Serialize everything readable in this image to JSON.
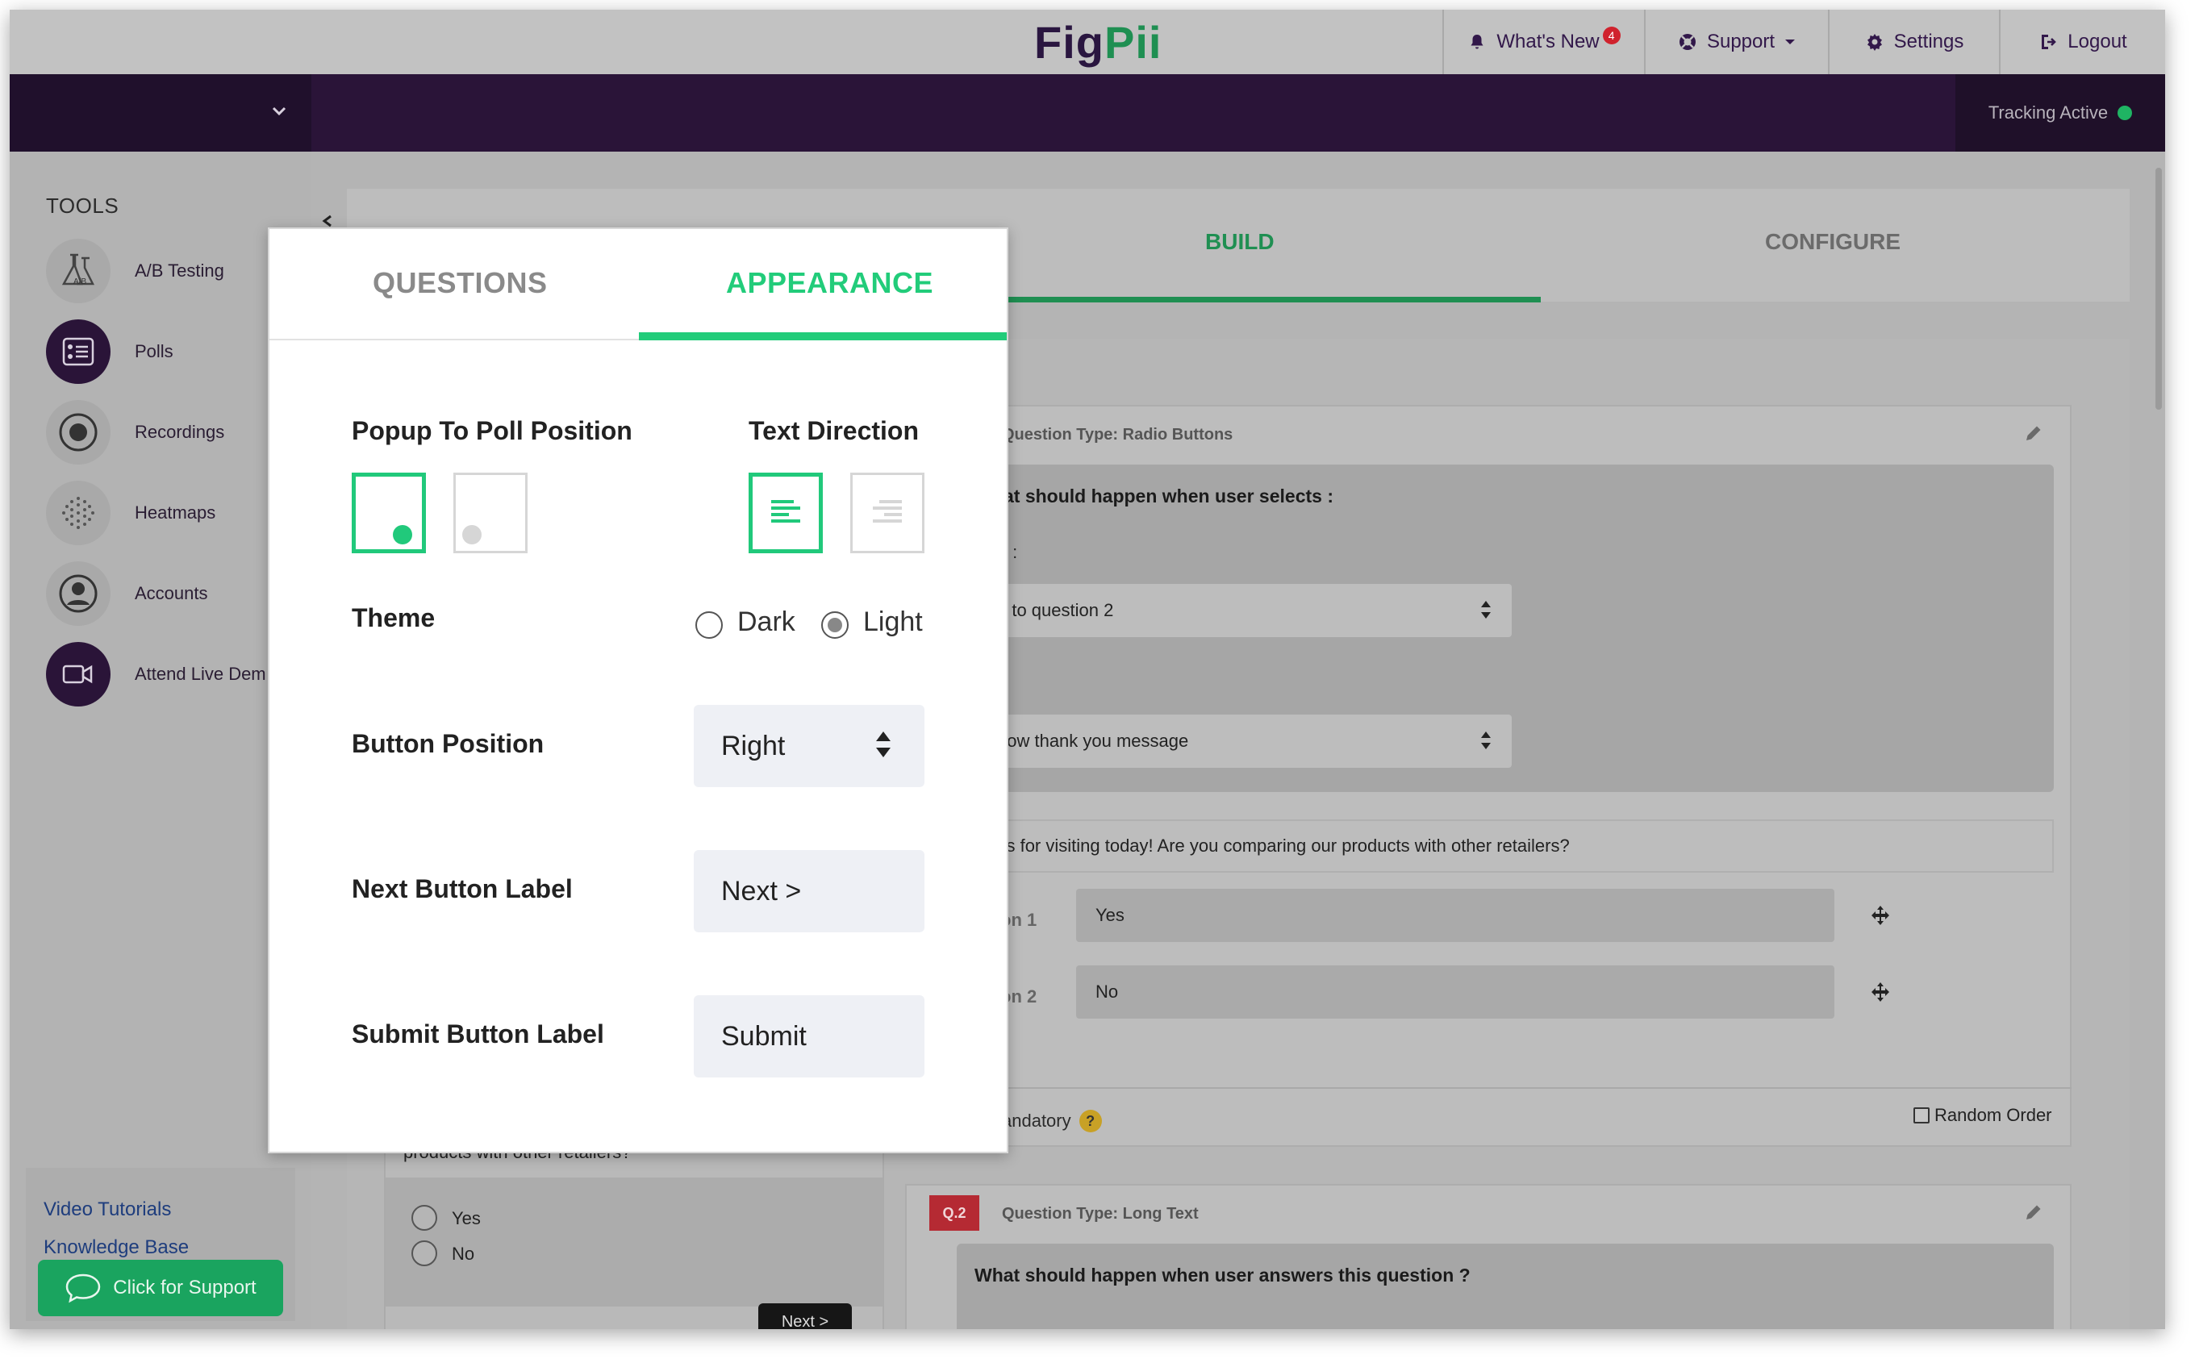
{
  "header": {
    "logo_fig": "Fig",
    "logo_pii": "Pii",
    "whats_new": "What's New",
    "whats_new_count": "4",
    "support": "Support",
    "settings": "Settings",
    "logout": "Logout"
  },
  "band": {
    "tracking_status": "Tracking Active"
  },
  "sidebar": {
    "heading": "TOOLS",
    "items": [
      {
        "label": "A/B Testing",
        "icon": "flask-icon"
      },
      {
        "label": "Polls",
        "icon": "list-icon"
      },
      {
        "label": "Recordings",
        "icon": "record-icon"
      },
      {
        "label": "Heatmaps",
        "icon": "heatmap-icon"
      },
      {
        "label": "Accounts",
        "icon": "user-icon"
      },
      {
        "label": "Attend Live Dem",
        "icon": "video-icon"
      }
    ],
    "video_tutorials": "Video Tutorials",
    "knowledge_base": "Knowledge Base",
    "support_button": "Click for Support"
  },
  "main": {
    "tabs": [
      {
        "label": "BUILD"
      },
      {
        "label": "CONFIGURE"
      }
    ],
    "question1": {
      "type": "Question Type: Radio Buttons",
      "logic_title": "at should happen when user selects :",
      "label_s": "s :",
      "select1": "o to question 2",
      "label_colon": ":",
      "select2": "how thank you message",
      "question_text": "anks for visiting today! Are you comparing our products with other retailers?",
      "options": [
        {
          "label": "on 1",
          "value": "Yes"
        },
        {
          "label": "on 2",
          "value": "No"
        }
      ],
      "mandatory": "andatory",
      "help": "?",
      "random_order": "Random Order"
    },
    "question2": {
      "badge": "Q.2",
      "type": "Question Type: Long Text",
      "logic_title": "What should happen when user answers this question ?"
    },
    "preview": {
      "text": "products with other retailers?",
      "options": [
        "Yes",
        "No"
      ],
      "next": "Next >"
    }
  },
  "modal": {
    "tabs": {
      "questions": "QUESTIONS",
      "appearance": "APPEARANCE"
    },
    "popup_position_label": "Popup To Poll Position",
    "text_direction_label": "Text Direction",
    "theme_label": "Theme",
    "theme_options": {
      "dark": "Dark",
      "light": "Light"
    },
    "theme_selected": "Light",
    "button_position_label": "Button Position",
    "button_position_value": "Right",
    "next_button_label": "Next Button Label",
    "next_button_value": "Next >",
    "submit_button_label": "Submit Button Label",
    "submit_button_value": "Submit"
  },
  "colors": {
    "brand_purple": "#2a1438",
    "brand_green": "#22cc7a",
    "badge_red": "#b52a33"
  }
}
